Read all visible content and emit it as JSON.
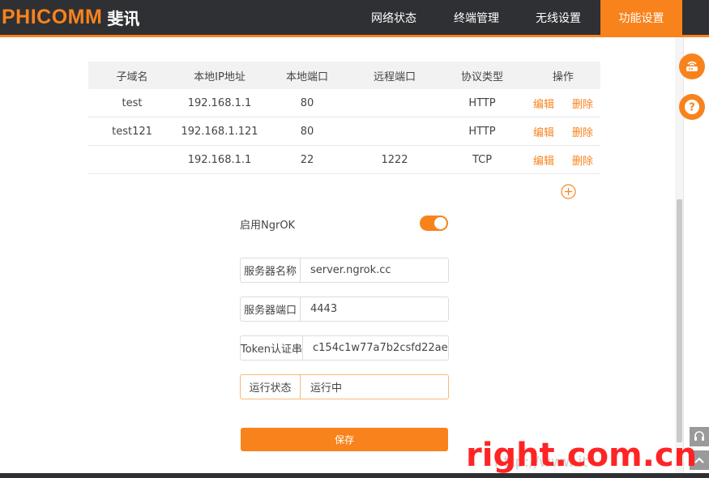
{
  "header": {
    "logo_en": "PHICOMM",
    "logo_cn": "斐讯",
    "nav": [
      "网络状态",
      "终端管理",
      "无线设置",
      "功能设置"
    ],
    "active_nav": "功能设置",
    "accent_color": "#f8831d"
  },
  "table": {
    "columns": [
      "子域名",
      "本地IP地址",
      "本地端口",
      "远程端口",
      "协议类型",
      "操作"
    ],
    "rows": [
      {
        "subdomain": "test",
        "local_ip": "192.168.1.1",
        "local_port": "80",
        "remote_port": "",
        "protocol": "HTTP",
        "edit": "编辑",
        "delete": "删除"
      },
      {
        "subdomain": "test121",
        "local_ip": "192.168.1.121",
        "local_port": "80",
        "remote_port": "",
        "protocol": "HTTP",
        "edit": "编辑",
        "delete": "删除"
      },
      {
        "subdomain": "",
        "local_ip": "192.168.1.1",
        "local_port": "22",
        "remote_port": "1222",
        "protocol": "TCP",
        "edit": "编辑",
        "delete": "删除"
      }
    ]
  },
  "form": {
    "ngrok_label": "启用NgrOK",
    "ngrok_enabled": true,
    "server_name_label": "服务器名称",
    "server_name_value": "server.ngrok.cc",
    "server_port_label": "服务器端口",
    "server_port_value": "4443",
    "token_label": "Token认证串",
    "token_value": "c154c1w77a7b2csfd22ae",
    "status_label": "运行状态",
    "status_value": "运行中",
    "save_label": "保存"
  },
  "icons": {
    "add": "plus-circle-icon",
    "router": "router-icon",
    "help": "question-icon"
  },
  "watermark": {
    "text": "right.com.cn",
    "sub": "http://www.it"
  }
}
